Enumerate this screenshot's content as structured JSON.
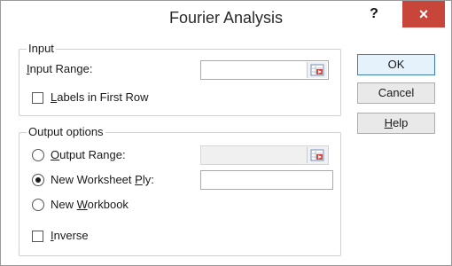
{
  "dialog": {
    "title": "Fourier Analysis",
    "help_glyph": "?",
    "close_glyph": "×"
  },
  "input_group": {
    "label": "Input",
    "input_range_label": {
      "pre": "",
      "accel": "I",
      "post": "nput Range:"
    },
    "input_range_value": "",
    "labels_checkbox": {
      "pre": "",
      "accel": "L",
      "post": "abels in First Row",
      "checked": false
    }
  },
  "output_group": {
    "label": "Output options",
    "output_range": {
      "pre": "",
      "accel": "O",
      "post": "utput Range:",
      "selected": false,
      "value": "",
      "enabled": false
    },
    "new_worksheet": {
      "pre": "New Worksheet ",
      "accel": "P",
      "post": "ly:",
      "selected": true,
      "value": ""
    },
    "new_workbook": {
      "pre": "New ",
      "accel": "W",
      "post": "orkbook",
      "selected": false
    },
    "inverse_checkbox": {
      "pre": "",
      "accel": "I",
      "post": "nverse",
      "checked": false
    }
  },
  "buttons": {
    "ok": "OK",
    "cancel": "Cancel",
    "help": {
      "pre": "",
      "accel": "H",
      "post": "elp"
    }
  },
  "icons": {
    "range_picker": "range-select-icon",
    "help": "question-icon",
    "close": "close-icon"
  },
  "colors": {
    "close_button": "#c8453a",
    "default_button_border": "#3c7fb1"
  }
}
